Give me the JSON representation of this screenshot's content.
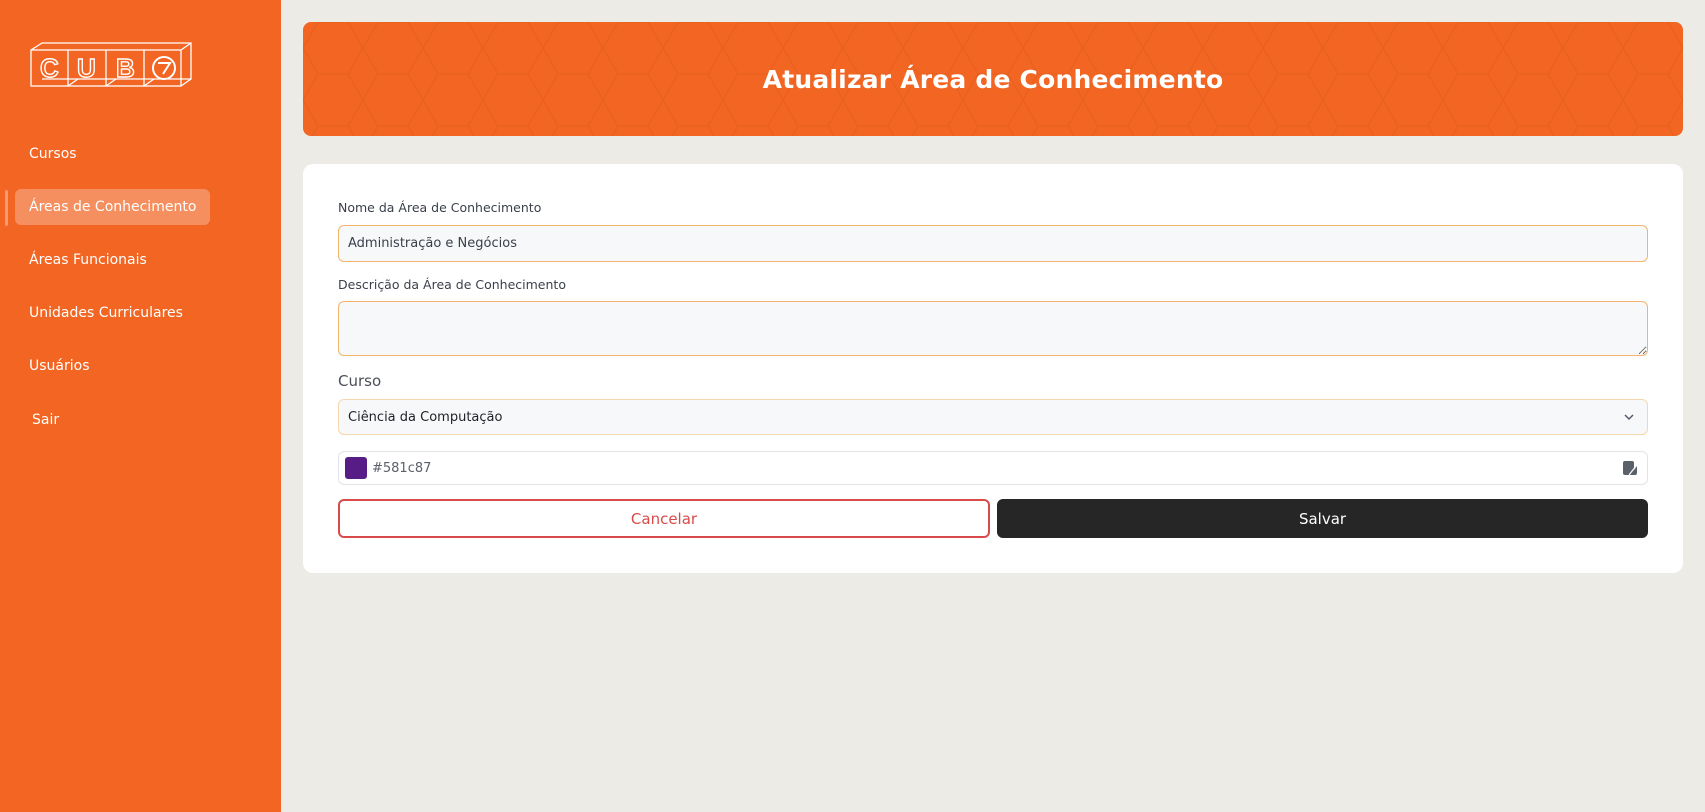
{
  "app": {
    "logo_text": "CUBO"
  },
  "sidebar": {
    "items": [
      {
        "label": "Cursos"
      },
      {
        "label": "Áreas de Conhecimento",
        "active": true
      },
      {
        "label": "Áreas Funcionais"
      },
      {
        "label": "Unidades Curriculares"
      },
      {
        "label": "Usuários"
      },
      {
        "label": "Sair"
      }
    ]
  },
  "header": {
    "title": "Atualizar Área de Conhecimento"
  },
  "form": {
    "name_label": "Nome da Área de Conhecimento",
    "name_value": "Administração e Negócios",
    "description_label": "Descrição da Área de Conhecimento",
    "description_value": "",
    "course_label": "Curso",
    "course_selected": "Ciência da Computação",
    "color_value": "#581c87",
    "cancel_label": "Cancelar",
    "save_label": "Salvar"
  },
  "colors": {
    "brand": "#f26522",
    "background": "#edebe6",
    "danger": "#d94a4a",
    "primary_button": "#262626"
  },
  "icons": {
    "chevron": "chevron-down-icon",
    "eyedropper": "eyedropper-icon"
  }
}
